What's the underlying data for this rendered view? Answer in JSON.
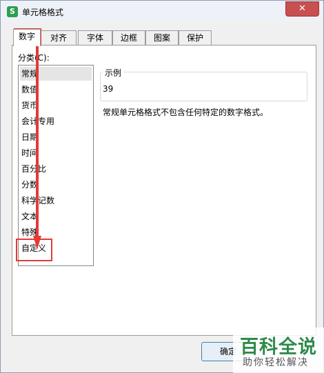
{
  "window": {
    "title": "单元格格式",
    "app_icon": "S",
    "close_label": "✕"
  },
  "tabs": [
    {
      "label": "数字",
      "active": true
    },
    {
      "label": "对齐",
      "active": false
    },
    {
      "label": "字体",
      "active": false
    },
    {
      "label": "边框",
      "active": false
    },
    {
      "label": "图案",
      "active": false
    },
    {
      "label": "保护",
      "active": false
    }
  ],
  "category": {
    "label": "分类(C):",
    "items": [
      "常规",
      "数值",
      "货币",
      "会计专用",
      "日期",
      "时间",
      "百分比",
      "分数",
      "科学记数",
      "文本",
      "特殊",
      "自定义"
    ],
    "selected": "常规"
  },
  "sample": {
    "legend": "示例",
    "value": "39"
  },
  "description": "常规单元格格式不包含任何特定的数字格式。",
  "buttons": {
    "ok": "确定"
  },
  "watermark": {
    "title": "百科全说",
    "subtitle": "助你轻松解决"
  },
  "colors": {
    "highlight": "#e53935",
    "selected_bg": "#e5e5e5",
    "brand_green": "#2f8a4a"
  }
}
